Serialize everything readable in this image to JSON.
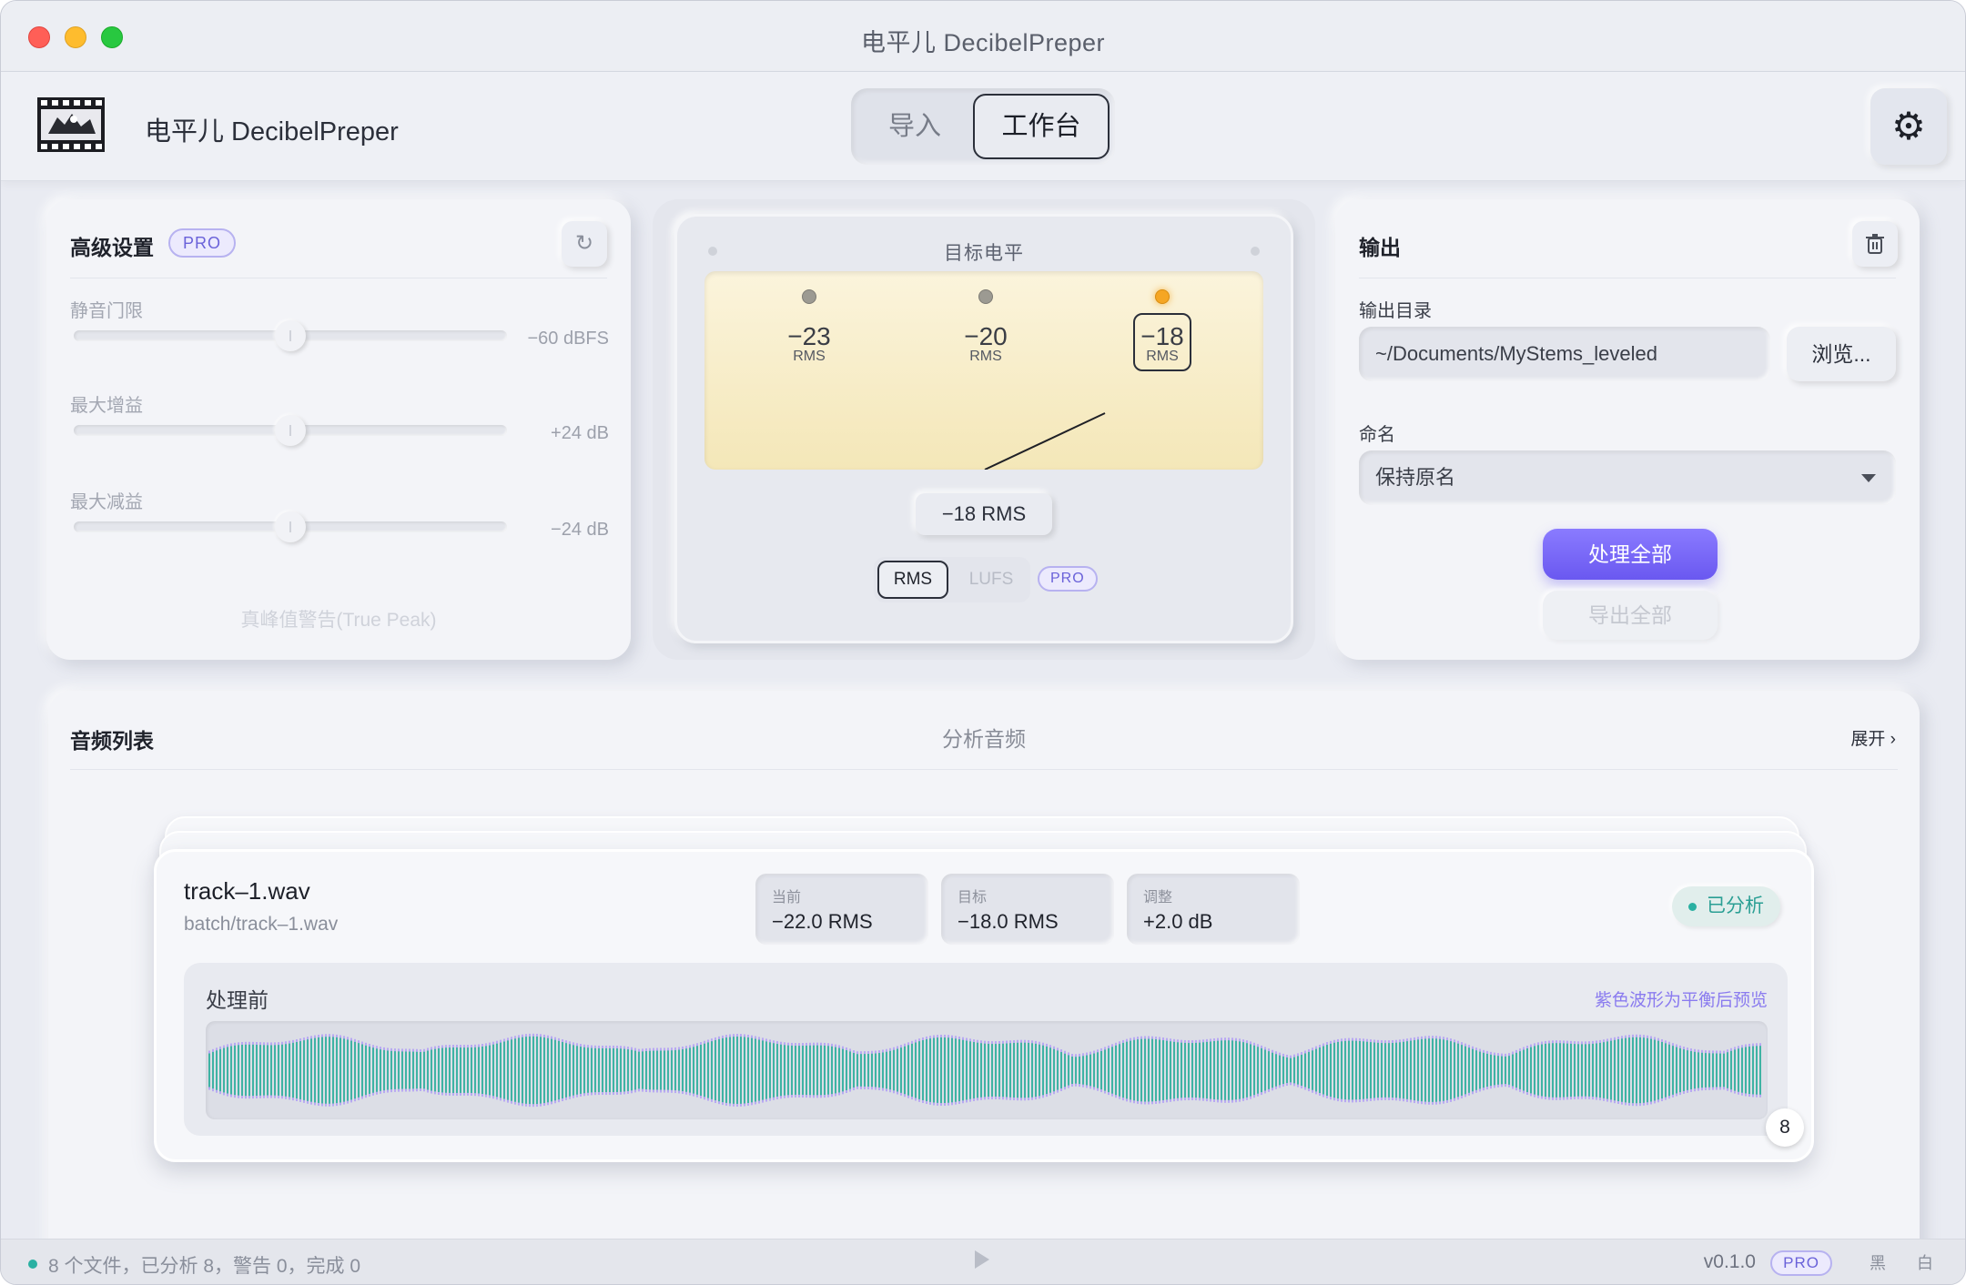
{
  "window": {
    "title": "电平儿 DecibelPreper"
  },
  "header": {
    "app_name": "电平儿 DecibelPreper",
    "tabs": [
      {
        "label": "导入",
        "active": false
      },
      {
        "label": "工作台",
        "active": true
      }
    ],
    "settings_icon": "gear-icon"
  },
  "advanced": {
    "title": "高级设置",
    "pro_badge": "PRO",
    "reset_icon": "reset-icon",
    "settings": [
      {
        "label": "静音门限",
        "value": "−60 dBFS",
        "fraction": 0.5
      },
      {
        "label": "最大增益",
        "value": "+24 dB",
        "fraction": 0.5
      },
      {
        "label": "最大减益",
        "value": "−24 dB",
        "fraction": 0.5
      }
    ],
    "true_peak": "真峰值警告(True Peak)"
  },
  "meter": {
    "title": "目标电平",
    "presets": [
      {
        "num": "−23",
        "unit": "RMS",
        "selected": false
      },
      {
        "num": "−20",
        "unit": "RMS",
        "selected": false
      },
      {
        "num": "−18",
        "unit": "RMS",
        "selected": true
      }
    ],
    "readout": "−18 RMS",
    "mode_rms": "RMS",
    "mode_lufs": "LUFS",
    "pro_badge": "PRO"
  },
  "output": {
    "title": "输出",
    "trash_icon": "trash-icon",
    "dir_label": "输出目录",
    "dir_value": "~/Documents/MyStems_leveled",
    "browse": "浏览...",
    "naming_label": "命名",
    "naming_value": "保持原名",
    "process_all": "处理全部",
    "export_all": "导出全部"
  },
  "audio_list": {
    "title": "音频列表",
    "center_label": "分析音频",
    "expand": "展开 ›",
    "track": {
      "name": "track–1.wav",
      "path": "batch/track–1.wav",
      "stats": [
        {
          "label": "当前",
          "value": "−22.0 RMS"
        },
        {
          "label": "目标",
          "value": "−18.0 RMS"
        },
        {
          "label": "调整",
          "value": "+2.0 dB"
        }
      ],
      "status": "已分析",
      "wave_title": "处理前",
      "wave_note": "紫色波形为平衡后预览",
      "count": "8"
    }
  },
  "statusbar": {
    "summary": "8 个文件，已分析 8，警告 0，完成 0",
    "version": "v0.1.0",
    "pro_badge": "PRO",
    "theme_dark": "黑",
    "theme_light": "白"
  },
  "colors": {
    "accent": "#6a58f0",
    "wave_teal": "#3fb3a4",
    "wave_purple": "#b7a8f2",
    "status_teal": "#2ab0a2",
    "lamp_on": "#f5a623"
  }
}
